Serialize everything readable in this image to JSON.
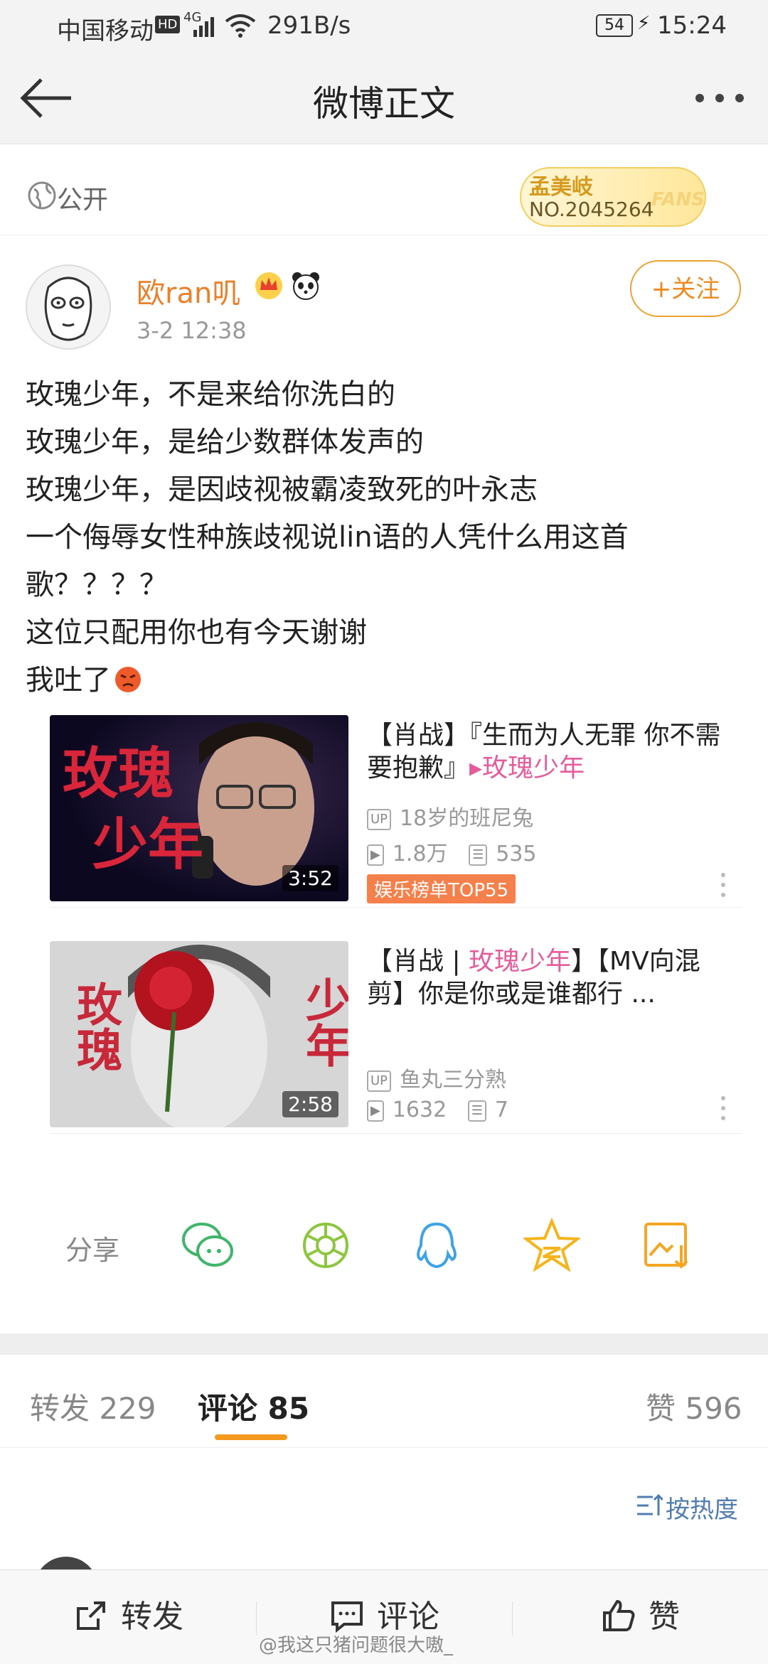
{
  "status_bar": {
    "carrier": "中国移动",
    "hd": "HD",
    "net": "4G",
    "speed": "291B/s",
    "battery": "54",
    "time": "15:24"
  },
  "nav": {
    "back_icon": "arrow-left-icon",
    "title": "微博正文",
    "more_icon": "more-dots-icon"
  },
  "visibility": {
    "icon": "globe-icon",
    "label": "公开"
  },
  "fans_badge": {
    "name": "孟美岐",
    "number": "NO.2045264",
    "watermark": "FANS"
  },
  "post": {
    "username": "欧ran叽",
    "date": "3-2 12:38",
    "follow_label": "+关注",
    "lines": [
      "玫瑰少年，不是来给你洗白的",
      "玫瑰少年，是给少数群体发声的",
      "玫瑰少年，是因歧视被霸凌致死的叶永志",
      "一个侮辱女性种族歧视说lin语的人凭什么用这首",
      "歌？？？？",
      "这位只配用你也有今天谢谢",
      "我吐了"
    ]
  },
  "videos": [
    {
      "title_a": "【肖战】『生而为人无罪 你不需要抱歉』",
      "title_b": "▸玫瑰少年",
      "uploader": "18岁的班尼兔",
      "plays": "1.8万",
      "danmaku": "535",
      "duration": "3:52",
      "tag": "娱乐榜单TOP55",
      "thumb_text_1": "玫瑰",
      "thumb_text_2": "少年",
      "up_badge": "UP"
    },
    {
      "title_a": "【肖战 | ",
      "title_b": "玫瑰少年",
      "title_c": "】【MV向混剪】你是你或是谁都行 ...",
      "uploader": "鱼丸三分熟",
      "plays": "1632",
      "danmaku": "7",
      "duration": "2:58",
      "thumb_text_1": "玫瑰",
      "thumb_text_2": "少年",
      "up_badge": "UP"
    }
  ],
  "share": {
    "label": "分享",
    "icons": [
      "wechat-icon",
      "moments-icon",
      "qq-icon",
      "qzone-icon",
      "save-image-icon"
    ],
    "colors": [
      "#3fb56a",
      "#8dc63f",
      "#3ea3e6",
      "#f5b41d",
      "#f5a623"
    ]
  },
  "tabs": {
    "repost": "转发 229",
    "comments": "评论 85",
    "likes": "赞 596"
  },
  "sort": {
    "label": "按热度"
  },
  "bottom_bar": {
    "repost": "转发",
    "comment": "评论",
    "like": "赞"
  },
  "watermark": "@我这只猪问题很大嗷_"
}
